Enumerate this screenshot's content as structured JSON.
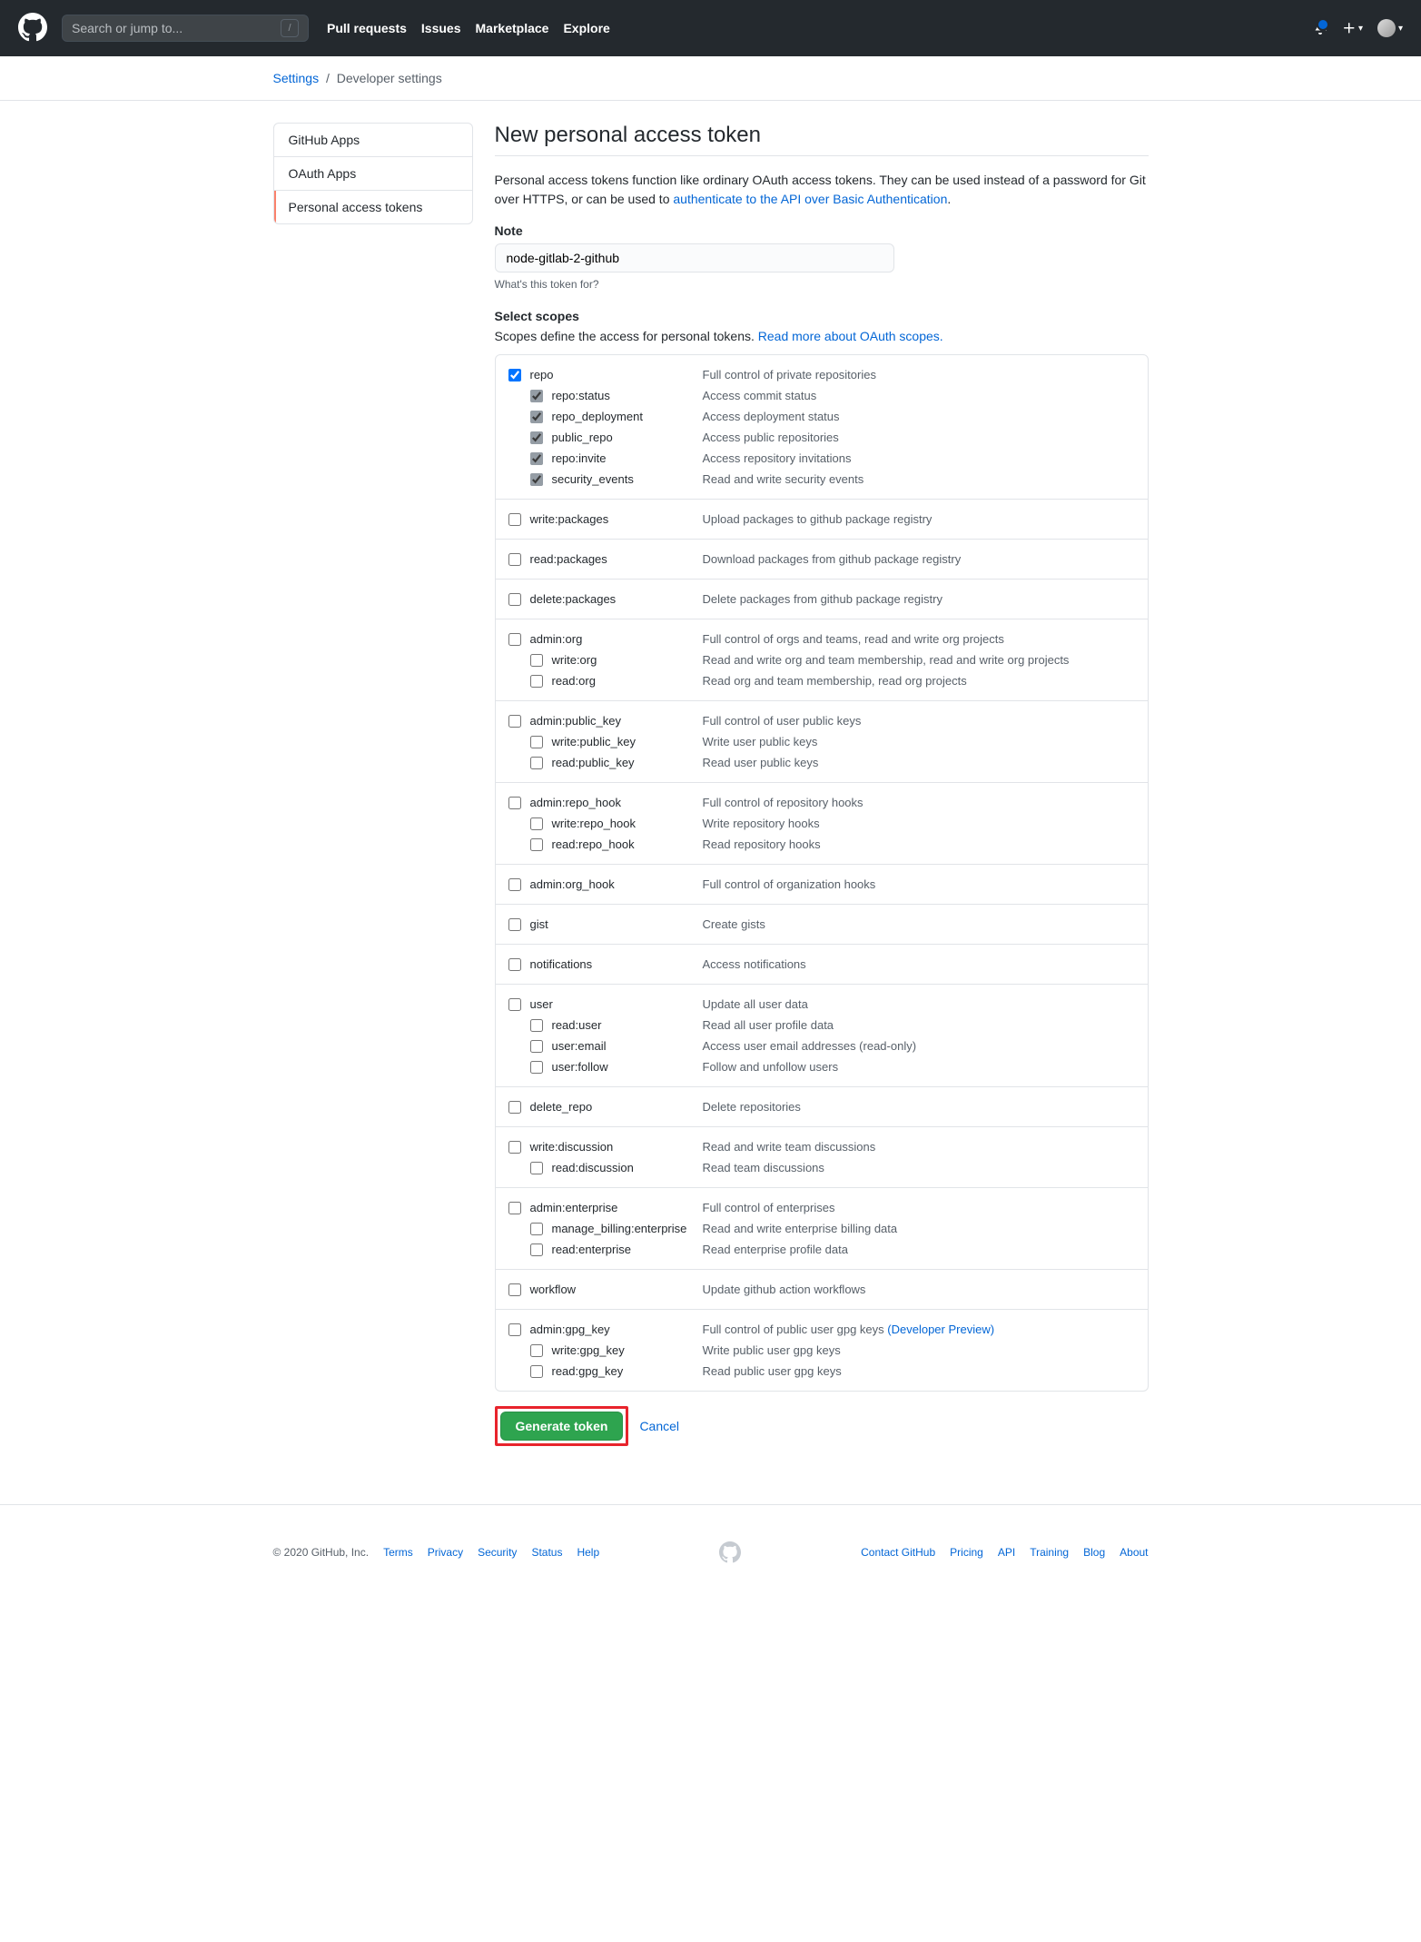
{
  "header": {
    "search_placeholder": "Search or jump to...",
    "nav": [
      "Pull requests",
      "Issues",
      "Marketplace",
      "Explore"
    ]
  },
  "breadcrumb": {
    "settings": "Settings",
    "dev": "Developer settings"
  },
  "sidebar": {
    "items": [
      {
        "label": "GitHub Apps"
      },
      {
        "label": "OAuth Apps"
      },
      {
        "label": "Personal access tokens"
      }
    ]
  },
  "page": {
    "title": "New personal access token",
    "desc1": "Personal access tokens function like ordinary OAuth access tokens. They can be used instead of a password for Git over HTTPS, or can be used to ",
    "desc_link": "authenticate to the API over Basic Authentication",
    "note_label": "Note",
    "note_value": "node-gitlab-2-github",
    "note_hint": "What's this token for?",
    "scopes_label": "Select scopes",
    "scopes_desc": "Scopes define the access for personal tokens. ",
    "scopes_link": "Read more about OAuth scopes.",
    "generate": "Generate token",
    "cancel": "Cancel"
  },
  "scopes": [
    {
      "rows": [
        {
          "name": "repo",
          "desc": "Full control of private repositories",
          "checked": true
        },
        {
          "name": "repo:status",
          "desc": "Access commit status",
          "sub": true,
          "checked": true,
          "gray": true
        },
        {
          "name": "repo_deployment",
          "desc": "Access deployment status",
          "sub": true,
          "checked": true,
          "gray": true
        },
        {
          "name": "public_repo",
          "desc": "Access public repositories",
          "sub": true,
          "checked": true,
          "gray": true
        },
        {
          "name": "repo:invite",
          "desc": "Access repository invitations",
          "sub": true,
          "checked": true,
          "gray": true
        },
        {
          "name": "security_events",
          "desc": "Read and write security events",
          "sub": true,
          "checked": true,
          "gray": true
        }
      ]
    },
    {
      "rows": [
        {
          "name": "write:packages",
          "desc": "Upload packages to github package registry"
        }
      ]
    },
    {
      "rows": [
        {
          "name": "read:packages",
          "desc": "Download packages from github package registry"
        }
      ]
    },
    {
      "rows": [
        {
          "name": "delete:packages",
          "desc": "Delete packages from github package registry"
        }
      ]
    },
    {
      "rows": [
        {
          "name": "admin:org",
          "desc": "Full control of orgs and teams, read and write org projects"
        },
        {
          "name": "write:org",
          "desc": "Read and write org and team membership, read and write org projects",
          "sub": true
        },
        {
          "name": "read:org",
          "desc": "Read org and team membership, read org projects",
          "sub": true
        }
      ]
    },
    {
      "rows": [
        {
          "name": "admin:public_key",
          "desc": "Full control of user public keys"
        },
        {
          "name": "write:public_key",
          "desc": "Write user public keys",
          "sub": true
        },
        {
          "name": "read:public_key",
          "desc": "Read user public keys",
          "sub": true
        }
      ]
    },
    {
      "rows": [
        {
          "name": "admin:repo_hook",
          "desc": "Full control of repository hooks"
        },
        {
          "name": "write:repo_hook",
          "desc": "Write repository hooks",
          "sub": true
        },
        {
          "name": "read:repo_hook",
          "desc": "Read repository hooks",
          "sub": true
        }
      ]
    },
    {
      "rows": [
        {
          "name": "admin:org_hook",
          "desc": "Full control of organization hooks"
        }
      ]
    },
    {
      "rows": [
        {
          "name": "gist",
          "desc": "Create gists"
        }
      ]
    },
    {
      "rows": [
        {
          "name": "notifications",
          "desc": "Access notifications"
        }
      ]
    },
    {
      "rows": [
        {
          "name": "user",
          "desc": "Update all user data"
        },
        {
          "name": "read:user",
          "desc": "Read all user profile data",
          "sub": true
        },
        {
          "name": "user:email",
          "desc": "Access user email addresses (read-only)",
          "sub": true
        },
        {
          "name": "user:follow",
          "desc": "Follow and unfollow users",
          "sub": true
        }
      ]
    },
    {
      "rows": [
        {
          "name": "delete_repo",
          "desc": "Delete repositories"
        }
      ]
    },
    {
      "rows": [
        {
          "name": "write:discussion",
          "desc": "Read and write team discussions"
        },
        {
          "name": "read:discussion",
          "desc": "Read team discussions",
          "sub": true
        }
      ]
    },
    {
      "rows": [
        {
          "name": "admin:enterprise",
          "desc": "Full control of enterprises"
        },
        {
          "name": "manage_billing:enterprise",
          "desc": "Read and write enterprise billing data",
          "sub": true
        },
        {
          "name": "read:enterprise",
          "desc": "Read enterprise profile data",
          "sub": true
        }
      ]
    },
    {
      "rows": [
        {
          "name": "workflow",
          "desc": "Update github action workflows"
        }
      ]
    },
    {
      "rows": [
        {
          "name": "admin:gpg_key",
          "desc": "Full control of public user gpg keys ",
          "link": "(Developer Preview)"
        },
        {
          "name": "write:gpg_key",
          "desc": "Write public user gpg keys",
          "sub": true
        },
        {
          "name": "read:gpg_key",
          "desc": "Read public user gpg keys",
          "sub": true
        }
      ]
    }
  ],
  "footer": {
    "copyright": "© 2020 GitHub, Inc.",
    "left": [
      "Terms",
      "Privacy",
      "Security",
      "Status",
      "Help"
    ],
    "right": [
      "Contact GitHub",
      "Pricing",
      "API",
      "Training",
      "Blog",
      "About"
    ]
  }
}
